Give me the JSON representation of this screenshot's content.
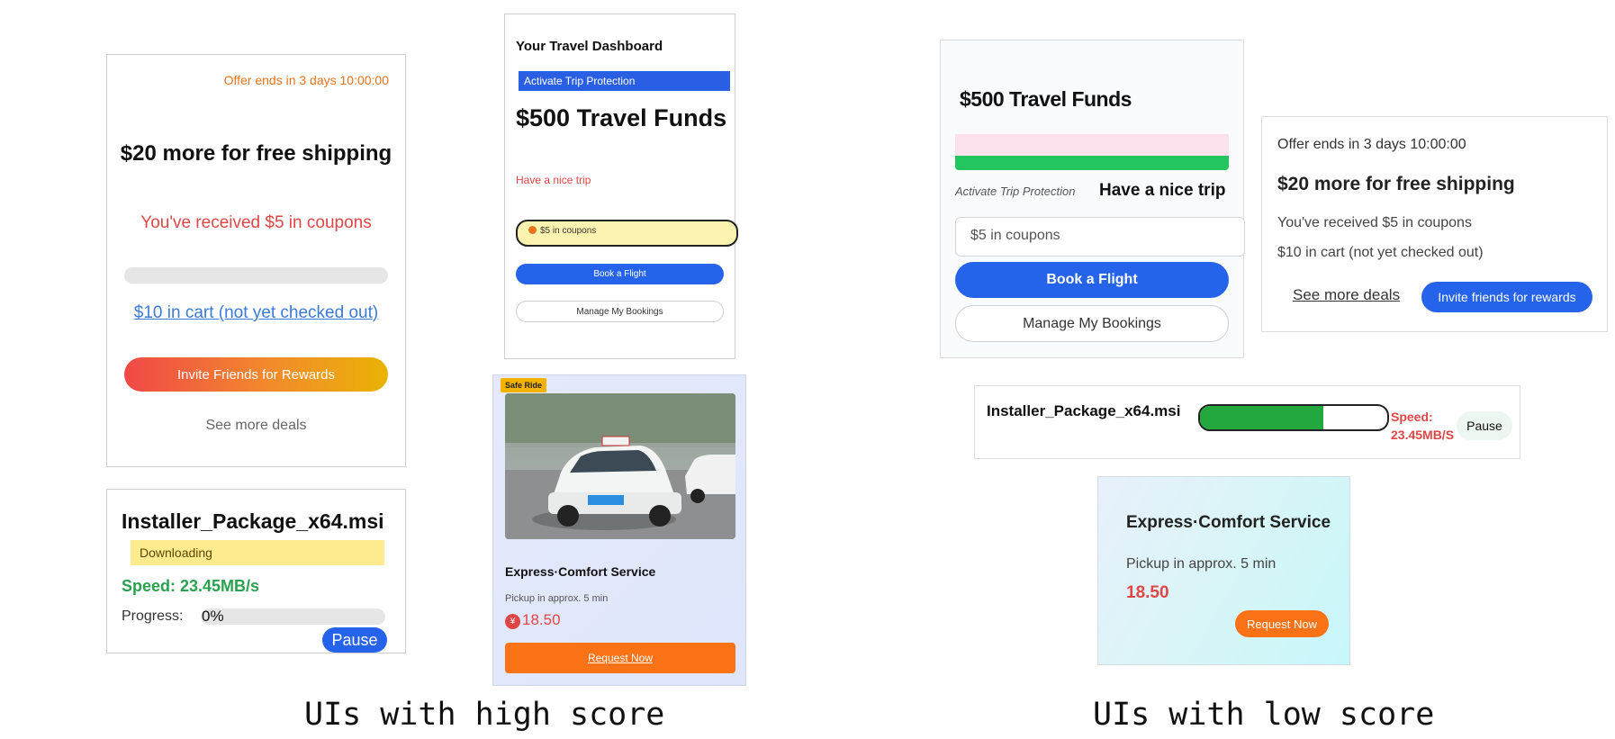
{
  "high": {
    "shipping": {
      "offer": "Offer ends in 3 days 10:00:00",
      "title": "$20 more for free shipping",
      "coupon": "You've received $5 in coupons",
      "cart": "$10 in cart (not yet checked out)",
      "invite": "Invite Friends for Rewards",
      "deals": "See more deals"
    },
    "installer": {
      "filename": "Installer_Package_x64.msi",
      "status": "Downloading",
      "speed": "Speed: 23.45MB/s",
      "progress_label": "Progress:",
      "progress_value": "0%",
      "pause": "Pause"
    },
    "travel": {
      "dashboard": "Your Travel Dashboard",
      "protection": "Activate Trip Protection",
      "funds": "$500 Travel Funds",
      "greeting": "Have a nice trip",
      "coupons": "$5 in coupons",
      "book": "Book a Flight",
      "manage": "Manage My Bookings"
    },
    "taxi": {
      "tag": "Safe Ride",
      "service": "Express·Comfort Service",
      "pickup": "Pickup in approx. 5 min",
      "currency": "¥",
      "price": "18.50",
      "request": "Request Now"
    }
  },
  "low": {
    "travel": {
      "funds": "$500 Travel Funds",
      "protection": "Activate Trip Protection",
      "greeting": "Have a nice trip",
      "coupons": "$5 in coupons",
      "book": "Book a Flight",
      "manage": "Manage My Bookings"
    },
    "shipping": {
      "offer": "Offer ends in 3 days 10:00:00",
      "title": "$20 more for free shipping",
      "coupon": "You've received $5 in coupons",
      "cart": "$10 in cart (not yet checked out)",
      "deals": "See more deals",
      "invite": "Invite friends for rewards"
    },
    "installer": {
      "filename": "Installer_Package_x64.msi",
      "progress_fraction": 0.66,
      "speed_label": "Speed:",
      "speed_value": "23.45MB/S",
      "pause": "Pause"
    },
    "taxi": {
      "service": "Express·Comfort Service",
      "pickup": "Pickup in approx. 5 min",
      "price": "18.50",
      "request": "Request Now"
    }
  },
  "captions": {
    "high": "UIs with high score",
    "low": "UIs with low score"
  },
  "colors": {
    "accent_blue": "#2563eb",
    "orange": "#f97316",
    "red": "#e04646",
    "green": "#22c55e"
  }
}
